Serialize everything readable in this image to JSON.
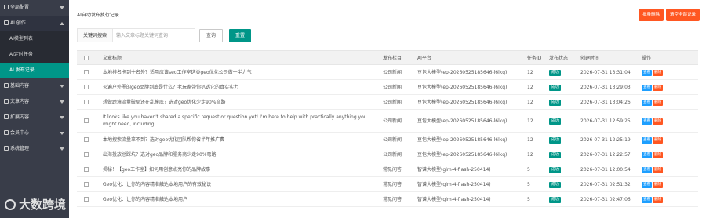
{
  "sidebar": {
    "items": [
      {
        "label": "全局配置",
        "type": "group",
        "arrow": "down"
      },
      {
        "label": "AI 创作",
        "type": "group-open",
        "arrow": "up"
      },
      {
        "label": "AI模型列表",
        "type": "sub"
      },
      {
        "label": "AI定时任务",
        "type": "sub"
      },
      {
        "label": "AI 发布记录",
        "type": "active"
      },
      {
        "label": "基础内容",
        "type": "group",
        "arrow": "down"
      },
      {
        "label": "文章内容",
        "type": "group",
        "arrow": "down"
      },
      {
        "label": "扩展内容",
        "type": "group",
        "arrow": "down"
      },
      {
        "label": "会员中心",
        "type": "group",
        "arrow": "down"
      },
      {
        "label": "系统管理",
        "type": "group",
        "arrow": "down"
      }
    ]
  },
  "watermark": {
    "text": "大数跨境"
  },
  "page": {
    "title": "AI自动发布执行记录"
  },
  "toolbar": {
    "batch_delete": "批量删除",
    "clear_all": "清空全部记录"
  },
  "search": {
    "label": "关键词搜索",
    "placeholder": "输入文章标题关键词查询",
    "query_button": "查询",
    "reset_button": "重置"
  },
  "table": {
    "headers": [
      "",
      "文章标题",
      "发布栏目",
      "AI平台",
      "任务ID",
      "发布状态",
      "创建时间",
      "操作"
    ],
    "status_label": "成功",
    "edit_label": "查看",
    "delete_label": "删除",
    "rows": [
      {
        "title": "本地排名卡到十名外？适用应该seo工作室这类geo优化公司做一半力气",
        "column": "公司新闻",
        "platform": "豆包大模型(ep-20260525185646-l6lkq)",
        "task_id": "12",
        "time": "2026-07-31 13:31:04",
        "tall": false
      },
      {
        "title": "火遍户外圈的geo品牌到底是什么？老玩家带你扒透它的真实实力",
        "column": "公司新闻",
        "platform": "豆包大模型(ep-20260525185646-l6lkq)",
        "task_id": "12",
        "time": "2026-07-31 13:29:03",
        "tall": false
      },
      {
        "title": "想做跨境流量破局还在乱摸底？选对geo优化少走90%弯路",
        "column": "公司新闻",
        "platform": "豆包大模型(ep-20260525185646-l6lkq)",
        "task_id": "12",
        "time": "2026-07-31 13:04:26",
        "tall": false
      },
      {
        "title": "It looks like you haven't shared a specific request or question yet! I'm here to help with practically anything you might need, including:",
        "column": "公司新闻",
        "platform": "豆包大模型(ep-20260525185646-l6lkq)",
        "task_id": "12",
        "time": "2026-07-31 12:59:25",
        "tall": true
      },
      {
        "title": "本地搜索流量拿不到？选对geo优化团队帮你省半年推广费",
        "column": "公司新闻",
        "platform": "豆包大模型(ep-20260525185646-l6lkq)",
        "task_id": "12",
        "time": "2026-07-31 12:25:19",
        "tall": false
      },
      {
        "title": "出海投放总踩坑？选对geo品牌和服务商少走90%弯路",
        "column": "公司新闻",
        "platform": "豆包大模型(ep-20260525185646-l6lkq)",
        "task_id": "12",
        "time": "2026-07-31 12:22:57",
        "tall": false
      },
      {
        "title": "揭秘！【geo工作室】如何用创意点亮你的品牌故事",
        "column": "常见问答",
        "platform": "智谱大模型(glm-4-flash-250414)",
        "task_id": "5",
        "time": "2026-07-31 12:00:54",
        "tall": false
      },
      {
        "title": "Geo优化：让你的内容精准触达本地用户的有效秘诀",
        "column": "常见问答",
        "platform": "智谱大模型(glm-4-flash-250414)",
        "task_id": "5",
        "time": "2026-07-31 02:51:32",
        "tall": false
      },
      {
        "title": "Geo优化：让你的内容精准触达本地用户",
        "column": "常见问答",
        "platform": "智谱大模型(glm-4-flash-250414)",
        "task_id": "5",
        "time": "2026-07-31 02:47:06",
        "tall": false
      }
    ]
  },
  "colors": {
    "sidebar_bg": "#393d49",
    "active": "#009688",
    "danger": "#ff5722",
    "info": "#1e9fff"
  }
}
